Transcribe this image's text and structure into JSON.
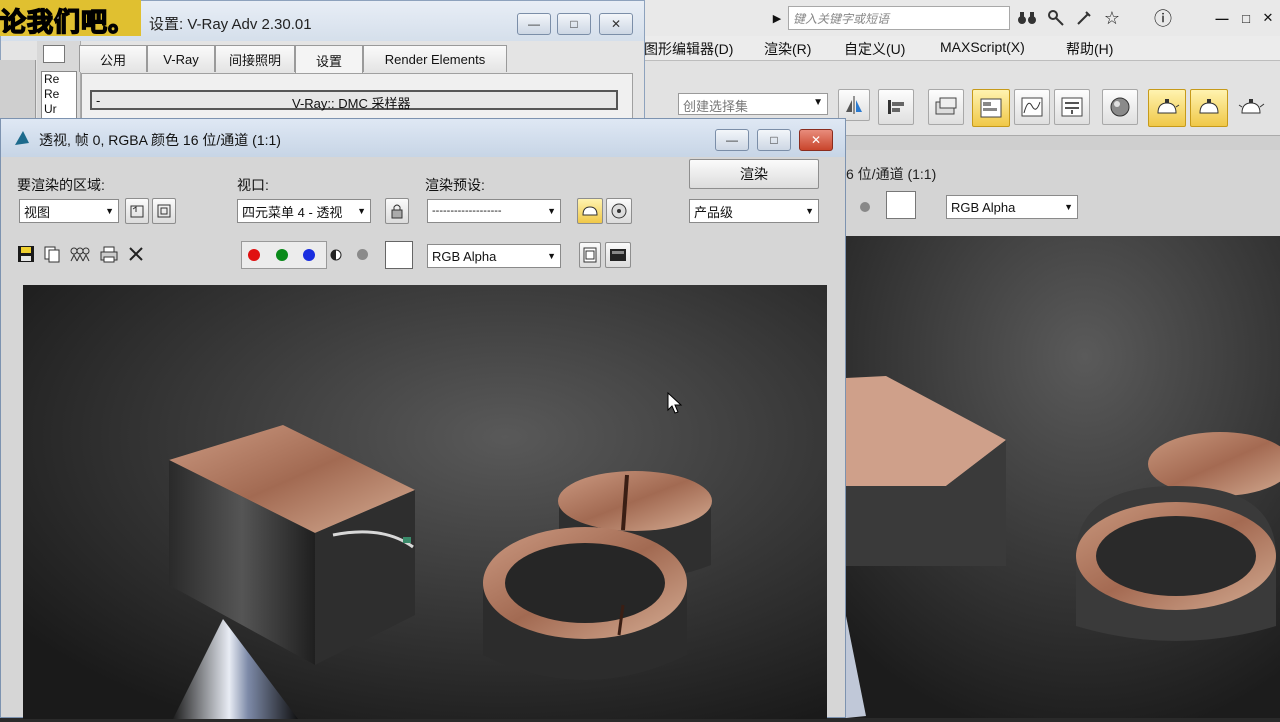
{
  "watermark": "论我们吧。",
  "main_app": {
    "search_placeholder": "键入关键字或短语",
    "menu": [
      "图形编辑器(D)",
      "渲染(R)",
      "自定义(U)",
      "MAXScript(X)",
      "帮助(H)"
    ],
    "selection_set_placeholder": "创建选择集",
    "window_ctrl": [
      "—",
      "□",
      "✕"
    ]
  },
  "render_setup": {
    "title": "设置: V-Ray Adv 2.30.01",
    "tabs": [
      "公用",
      "V-Ray",
      "间接照明",
      "设置",
      "Render Elements"
    ],
    "active_tab_index": 3,
    "rollout_toggle": "-",
    "rollout_label": "V-Ray:: DMC 采样器",
    "left_list": [
      "Re",
      "Re",
      "Ur"
    ]
  },
  "frame_window": {
    "title": "透视, 帧 0, RGBA 颜色 16 位/通道 (1:1)",
    "area_label": "要渲染的区域:",
    "area_value": "视图",
    "viewport_label": "视口:",
    "viewport_value": "四元菜单 4 - 透视",
    "preset_label": "渲染预设:",
    "preset_value": "-------------------",
    "render_button": "渲染",
    "quality_value": "产品级",
    "channel_value": "RGB Alpha",
    "channel_colors": {
      "red": "#e01010",
      "green": "#0a8a1a",
      "blue": "#1a2ee0"
    }
  },
  "background_frame": {
    "title_fragment": "6 位/通道 (1:1)",
    "channel_value": "RGB Alpha"
  },
  "icons": [
    "save-icon",
    "copy-icon",
    "clone-icon",
    "print-icon",
    "clear-icon",
    "lock-icon",
    "pointer-cursor-icon",
    "help-icon",
    "search-binoculars-icon",
    "star-icon",
    "teapot-icon"
  ]
}
